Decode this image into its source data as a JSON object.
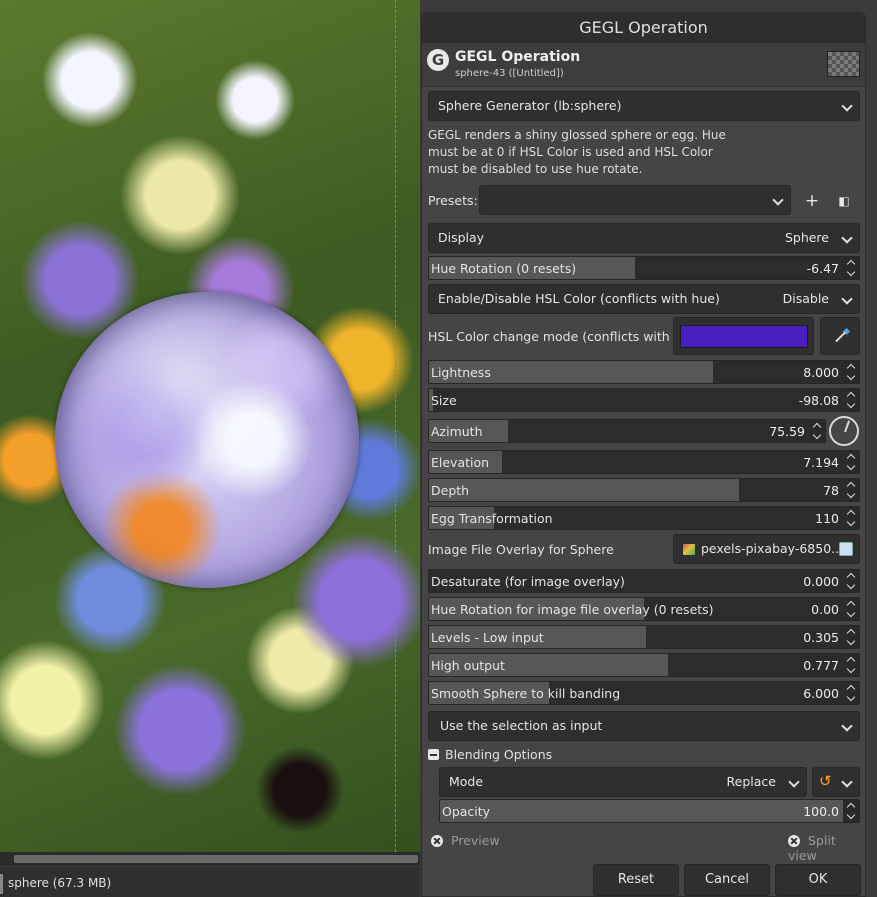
{
  "canvas": {
    "status_text": "sphere (67.3 MB)"
  },
  "dialog": {
    "window_title": "GEGL Operation",
    "header_title": "GEGL Operation",
    "header_subtitle": "sphere-43 ([Untitled])",
    "operation_selector": "Sphere Generator (lb:sphere)",
    "description": "GEGL renders a shiny glossed sphere or egg. Hue must be at 0 if HSL Color is used and HSL Color must be disabled to use hue rotate.",
    "presets_label": "Presets:",
    "presets_value": "",
    "display": {
      "label": "Display",
      "value": "Sphere"
    },
    "hue_rotation": {
      "label": "Hue Rotation (0 resets)",
      "value": "-6.47",
      "fill": 0.48
    },
    "hsl_toggle": {
      "label": "Enable/Disable HSL Color (conflicts with hue)",
      "value": "Disable"
    },
    "hsl_mode_label": "HSL Color change mode (conflicts with hue)",
    "hsl_color": "#4a1fbf",
    "sliders": [
      {
        "key": "lightness",
        "label": "Lightness",
        "value": "8.000",
        "fill": 0.66
      },
      {
        "key": "size",
        "label": "Size",
        "value": "-98.08",
        "fill": 0.01
      },
      {
        "key": "azimuth",
        "label": "Azimuth",
        "value": "75.59",
        "fill": 0.2
      },
      {
        "key": "elevation",
        "label": "Elevation",
        "value": "7.194",
        "fill": 0.17
      },
      {
        "key": "depth",
        "label": "Depth",
        "value": "78",
        "fill": 0.72
      },
      {
        "key": "egg",
        "label": "Egg Transformation",
        "value": "110",
        "fill": 0.15
      }
    ],
    "image_overlay": {
      "label": "Image File Overlay for Sphere",
      "file": "pexels-pixabay-6850..."
    },
    "sliders2": [
      {
        "key": "desaturate",
        "label": "Desaturate (for image overlay)",
        "value": "0.000",
        "fill": 0.0
      },
      {
        "key": "hue_overlay",
        "label": "Hue Rotation for image file overlay (0 resets)",
        "value": "0.00",
        "fill": 0.5
      },
      {
        "key": "low_input",
        "label": "Levels - Low input",
        "value": "0.305",
        "fill": 0.505
      },
      {
        "key": "high_output",
        "label": "High output",
        "value": "0.777",
        "fill": 0.555
      },
      {
        "key": "smooth",
        "label": "Smooth Sphere to kill banding",
        "value": "6.000",
        "fill": 0.28
      }
    ],
    "input_selector": "Use the selection as input",
    "blending": {
      "header": "Blending Options",
      "mode_label": "Mode",
      "mode_value": "Replace",
      "opacity_label": "Opacity",
      "opacity_value": "100.0",
      "opacity_fill": 1.0
    },
    "preview_label": "Preview",
    "split_view_label": "Split view",
    "buttons": {
      "reset": "Reset",
      "cancel": "Cancel",
      "ok": "OK"
    }
  }
}
